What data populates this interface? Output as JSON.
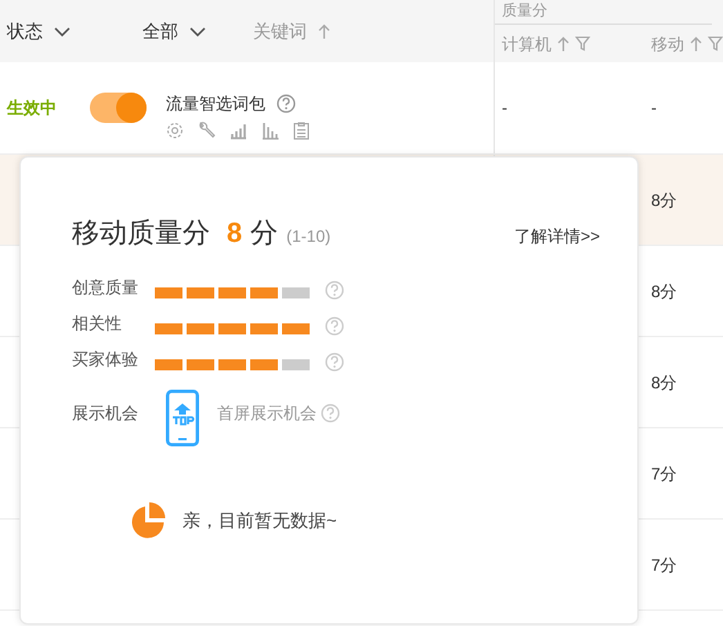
{
  "header": {
    "status_filter": "状态",
    "scope_filter": "全部",
    "keyword_column": "关键词",
    "quality_group": "质量分",
    "columns": [
      {
        "label": "计算机",
        "filter": true
      },
      {
        "label": "移动",
        "filter": true
      }
    ]
  },
  "rows": [
    {
      "status": "生效中",
      "on": true,
      "name": "流量智选词包",
      "pc": "-",
      "mobile": "-",
      "selected": false
    },
    {
      "mobile": "8分",
      "selected": true
    },
    {
      "mobile": "8分",
      "selected": false
    },
    {
      "mobile": "8分",
      "selected": false
    },
    {
      "mobile": "7分",
      "selected": false
    },
    {
      "mobile": "7分",
      "selected": false
    }
  ],
  "popup": {
    "title": "移动质量分",
    "score": "8",
    "unit": "分",
    "range": "(1-10)",
    "link": "了解详情>>",
    "metrics": [
      {
        "label": "创意质量",
        "level": 0.8
      },
      {
        "label": "相关性",
        "level": 1
      },
      {
        "label": "买家体验",
        "level": 0.8
      }
    ],
    "exposure": {
      "label": "展示机会",
      "text": "首屏展示机会"
    },
    "empty_message": "亲，目前暂无数据~"
  }
}
